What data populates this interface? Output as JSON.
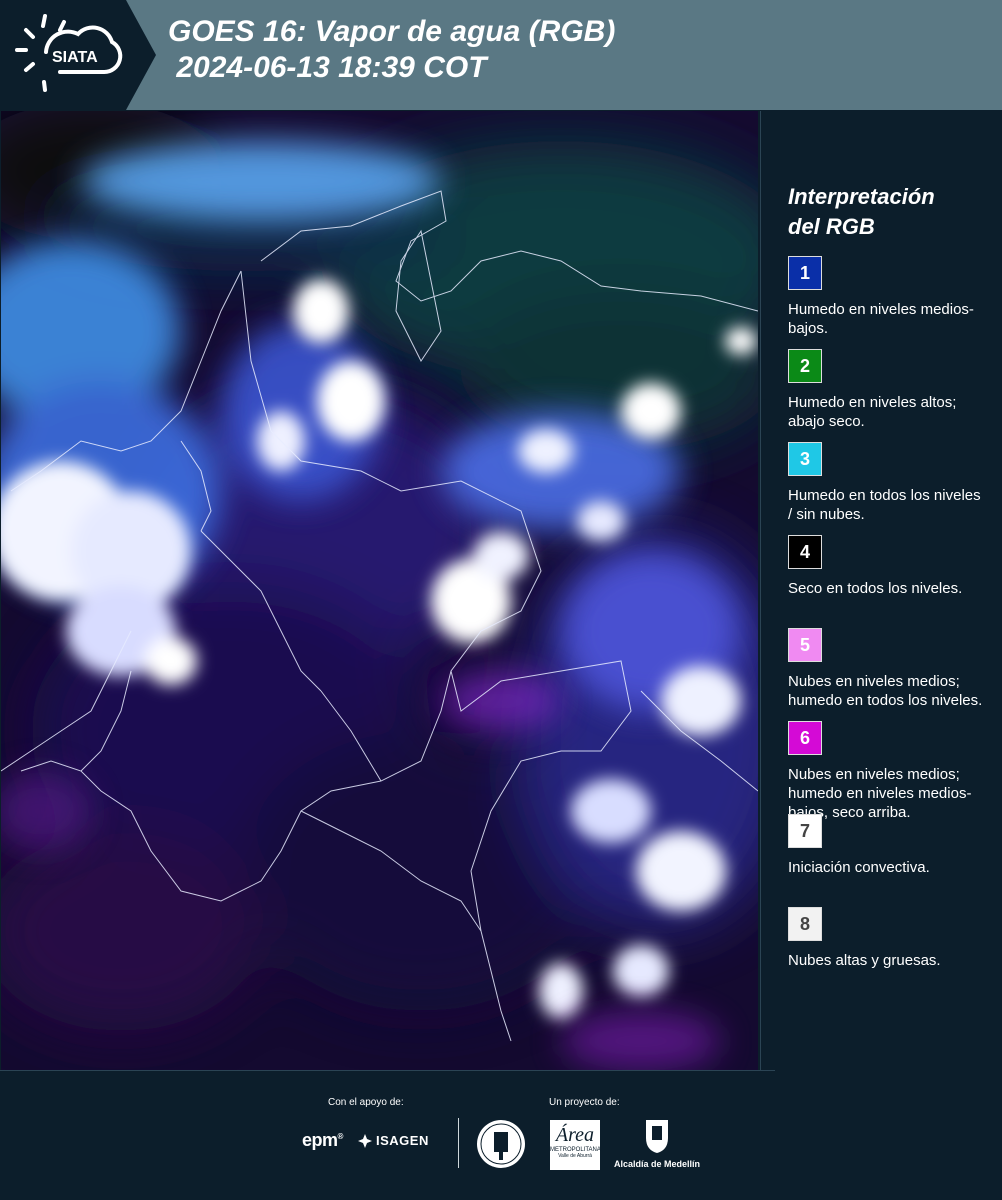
{
  "header": {
    "logo_text": "SIATA",
    "title_line1": "GOES 16: Vapor de agua (RGB)",
    "title_line2": " 2024-06-13 18:39 COT"
  },
  "legend": {
    "title_line1": "Interpretación",
    "title_line2": "del RGB",
    "items": [
      {
        "number": "1",
        "color": "#0a2fa8",
        "text_color": "#ffffff",
        "text": "Humedo en niveles medios-bajos."
      },
      {
        "number": "2",
        "color": "#0b8a17",
        "text_color": "#ffffff",
        "text": "Humedo en niveles altos; abajo seco."
      },
      {
        "number": "3",
        "color": "#1fc8e6",
        "text_color": "#ffffff",
        "text": "Humedo en todos los niveles / sin nubes."
      },
      {
        "number": "4",
        "color": "#000000",
        "text_color": "#ffffff",
        "text": "Seco en todos los niveles."
      },
      {
        "number": "5",
        "color": "#f08af2",
        "text_color": "#ffffff",
        "text": "Nubes en niveles medios; humedo en todos los niveles."
      },
      {
        "number": "6",
        "color": "#d40ad6",
        "text_color": "#ffffff",
        "text": "Nubes en niveles medios; humedo en niveles medios-bajos, seco arriba."
      },
      {
        "number": "7",
        "color": "#ffffff",
        "text_color": "#444444",
        "text": "Iniciación convectiva."
      },
      {
        "number": "8",
        "color": "#f2f2f2",
        "text_color": "#444444",
        "text": "Nubes altas y gruesas."
      }
    ]
  },
  "footer": {
    "support_label": "Con el apoyo de:",
    "project_label": "Un proyecto de:",
    "epm": "epm",
    "isagen": "ISAGEN",
    "area_name": "Área",
    "area_sub": "METROPOLITANA",
    "area_sub2": "Valle de Aburrá",
    "alcaldia": "Alcaldía de Medellín"
  },
  "colors": {
    "header_bg": "#5a7884",
    "logo_bg": "#0c1e2b",
    "page_bg": "#0c1e2b"
  }
}
